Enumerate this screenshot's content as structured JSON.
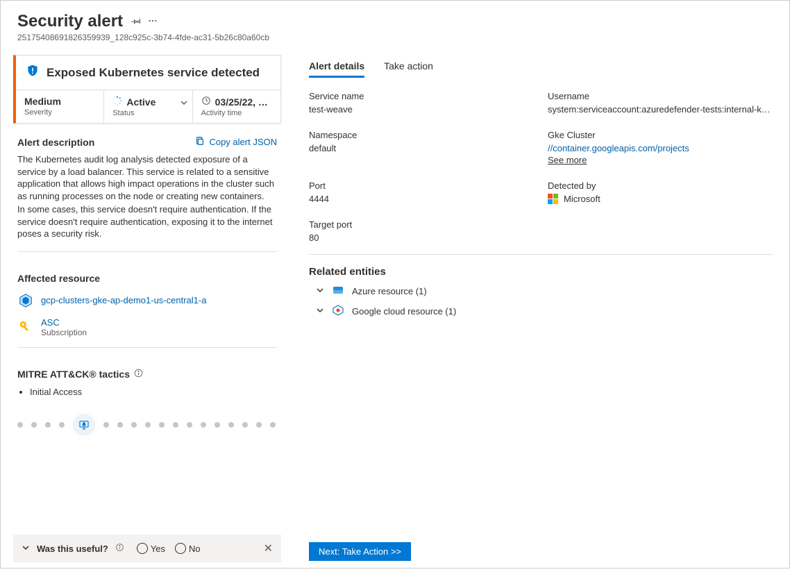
{
  "header": {
    "title": "Security alert",
    "id": "25175408691826359939_128c925c-3b74-4fde-ac31-5b26c80a60cb"
  },
  "alert": {
    "name": "Exposed Kubernetes service detected",
    "severity": "Medium",
    "severity_label": "Severity",
    "status": "Active",
    "status_label": "Status",
    "activity_time": "03/25/22, …",
    "activity_time_label": "Activity time"
  },
  "description": {
    "heading": "Alert description",
    "copy_label": "Copy alert JSON",
    "text1": "The Kubernetes audit log analysis detected exposure of a service by a load balancer. This service is related to a sensitive application that allows high impact operations in the cluster such as running processes on the node or creating new containers.",
    "text2": "In some cases, this service doesn't require authentication. If the service doesn't require authentication, exposing it to the internet poses a security risk."
  },
  "affected": {
    "heading": "Affected resource",
    "items": [
      {
        "name": "gcp-clusters-gke-ap-demo1-us-central1-a"
      },
      {
        "name": "ASC",
        "sub": "Subscription"
      }
    ]
  },
  "mitre": {
    "heading": "MITRE ATT&CK® tactics",
    "tactics": [
      "Initial Access"
    ]
  },
  "feedback": {
    "question": "Was this useful?",
    "yes": "Yes",
    "no": "No"
  },
  "tabs": {
    "details": "Alert details",
    "action": "Take action"
  },
  "details": {
    "service_name_label": "Service name",
    "service_name": "test-weave",
    "username_label": "Username",
    "username": "system:serviceaccount:azuredefender-tests:internal-k…",
    "namespace_label": "Namespace",
    "namespace": "default",
    "gke_label": "Gke Cluster",
    "gke_value": "//container.googleapis.com/projects",
    "see_more": "See more",
    "port_label": "Port",
    "port": "4444",
    "detected_by_label": "Detected by",
    "detected_by": "Microsoft",
    "target_port_label": "Target port",
    "target_port": "80"
  },
  "related": {
    "heading": "Related entities",
    "items": [
      {
        "label": "Azure resource (1)"
      },
      {
        "label": "Google cloud resource (1)"
      }
    ]
  },
  "action_button": "Next: Take Action >>"
}
